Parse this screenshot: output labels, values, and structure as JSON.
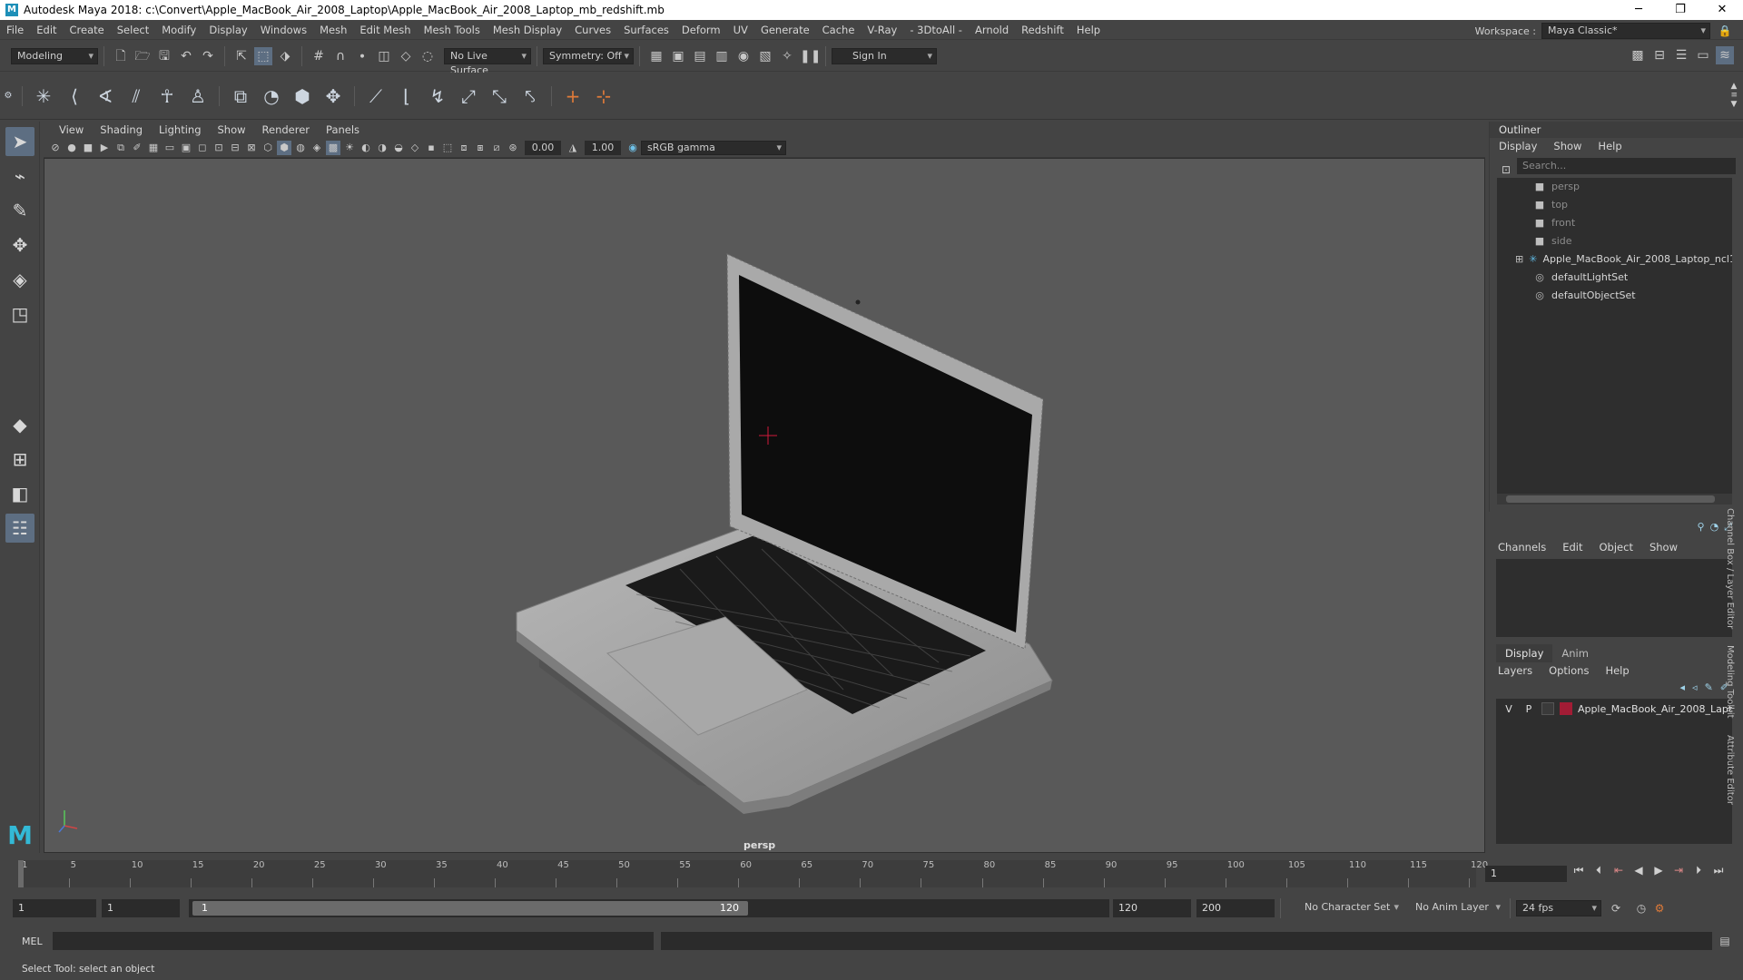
{
  "window": {
    "title": "Autodesk Maya 2018: c:\\Convert\\Apple_MacBook_Air_2008_Laptop\\Apple_MacBook_Air_2008_Laptop_mb_redshift.mb",
    "logo": "M",
    "min": "─",
    "max": "❐",
    "close": "✕"
  },
  "menubar": {
    "items": [
      "File",
      "Edit",
      "Create",
      "Select",
      "Modify",
      "Display",
      "Windows",
      "Mesh",
      "Edit Mesh",
      "Mesh Tools",
      "Mesh Display",
      "Curves",
      "Surfaces",
      "Deform",
      "UV",
      "Generate",
      "Cache",
      "V-Ray",
      "- 3DtoAll -",
      "Arnold",
      "Redshift",
      "Help"
    ],
    "workspace_label": "Workspace :",
    "workspace_value": "Maya Classic*"
  },
  "statusline": {
    "mode": "Modeling",
    "live_surface": "No Live Surface",
    "symmetry": "Symmetry: Off",
    "sign_in": "Sign In"
  },
  "viewport": {
    "menus": [
      "View",
      "Shading",
      "Lighting",
      "Show",
      "Renderer",
      "Panels"
    ],
    "exposure": "0.00",
    "gamma": "1.00",
    "color_space": "sRGB gamma",
    "camera_label": "persp"
  },
  "outliner": {
    "title": "Outliner",
    "menus": [
      "Display",
      "Show",
      "Help"
    ],
    "search_placeholder": "Search...",
    "items": [
      {
        "label": "persp",
        "dim": true,
        "icon": "camera-icon"
      },
      {
        "label": "top",
        "dim": true,
        "icon": "camera-icon"
      },
      {
        "label": "front",
        "dim": true,
        "icon": "camera-icon"
      },
      {
        "label": "side",
        "dim": true,
        "icon": "camera-icon"
      },
      {
        "label": "Apple_MacBook_Air_2008_Laptop_ncl1_",
        "dim": false,
        "icon": "group-icon"
      },
      {
        "label": "defaultLightSet",
        "dim": false,
        "icon": "set-icon"
      },
      {
        "label": "defaultObjectSet",
        "dim": false,
        "icon": "set-icon"
      }
    ]
  },
  "channelbox": {
    "menus": [
      "Channels",
      "Edit",
      "Object",
      "Show"
    ]
  },
  "layers": {
    "tabs": [
      "Display",
      "Anim"
    ],
    "menus": [
      "Layers",
      "Options",
      "Help"
    ],
    "row": {
      "v": "V",
      "p": "P",
      "name": "Apple_MacBook_Air_2008_Lapt",
      "color": "#a21c35"
    }
  },
  "vertical_tabs": [
    "Channel Box / Layer Editor",
    "Modeling Toolkit",
    "Attribute Editor"
  ],
  "timeline": {
    "ticks": [
      1,
      5,
      10,
      15,
      20,
      25,
      30,
      35,
      40,
      45,
      50,
      55,
      60,
      65,
      70,
      75,
      80,
      85,
      90,
      95,
      100,
      105,
      110,
      115,
      120
    ],
    "current_frame": "1"
  },
  "range": {
    "start": "1",
    "playback_start": "1",
    "knob_start": "1",
    "knob_end": "120",
    "playback_end": "120",
    "end": "200",
    "character_set": "No Character Set",
    "anim_layer": "No Anim Layer",
    "fps": "24 fps"
  },
  "cmdline": {
    "label": "MEL"
  },
  "helpline": {
    "text": "Select Tool: select an object"
  }
}
